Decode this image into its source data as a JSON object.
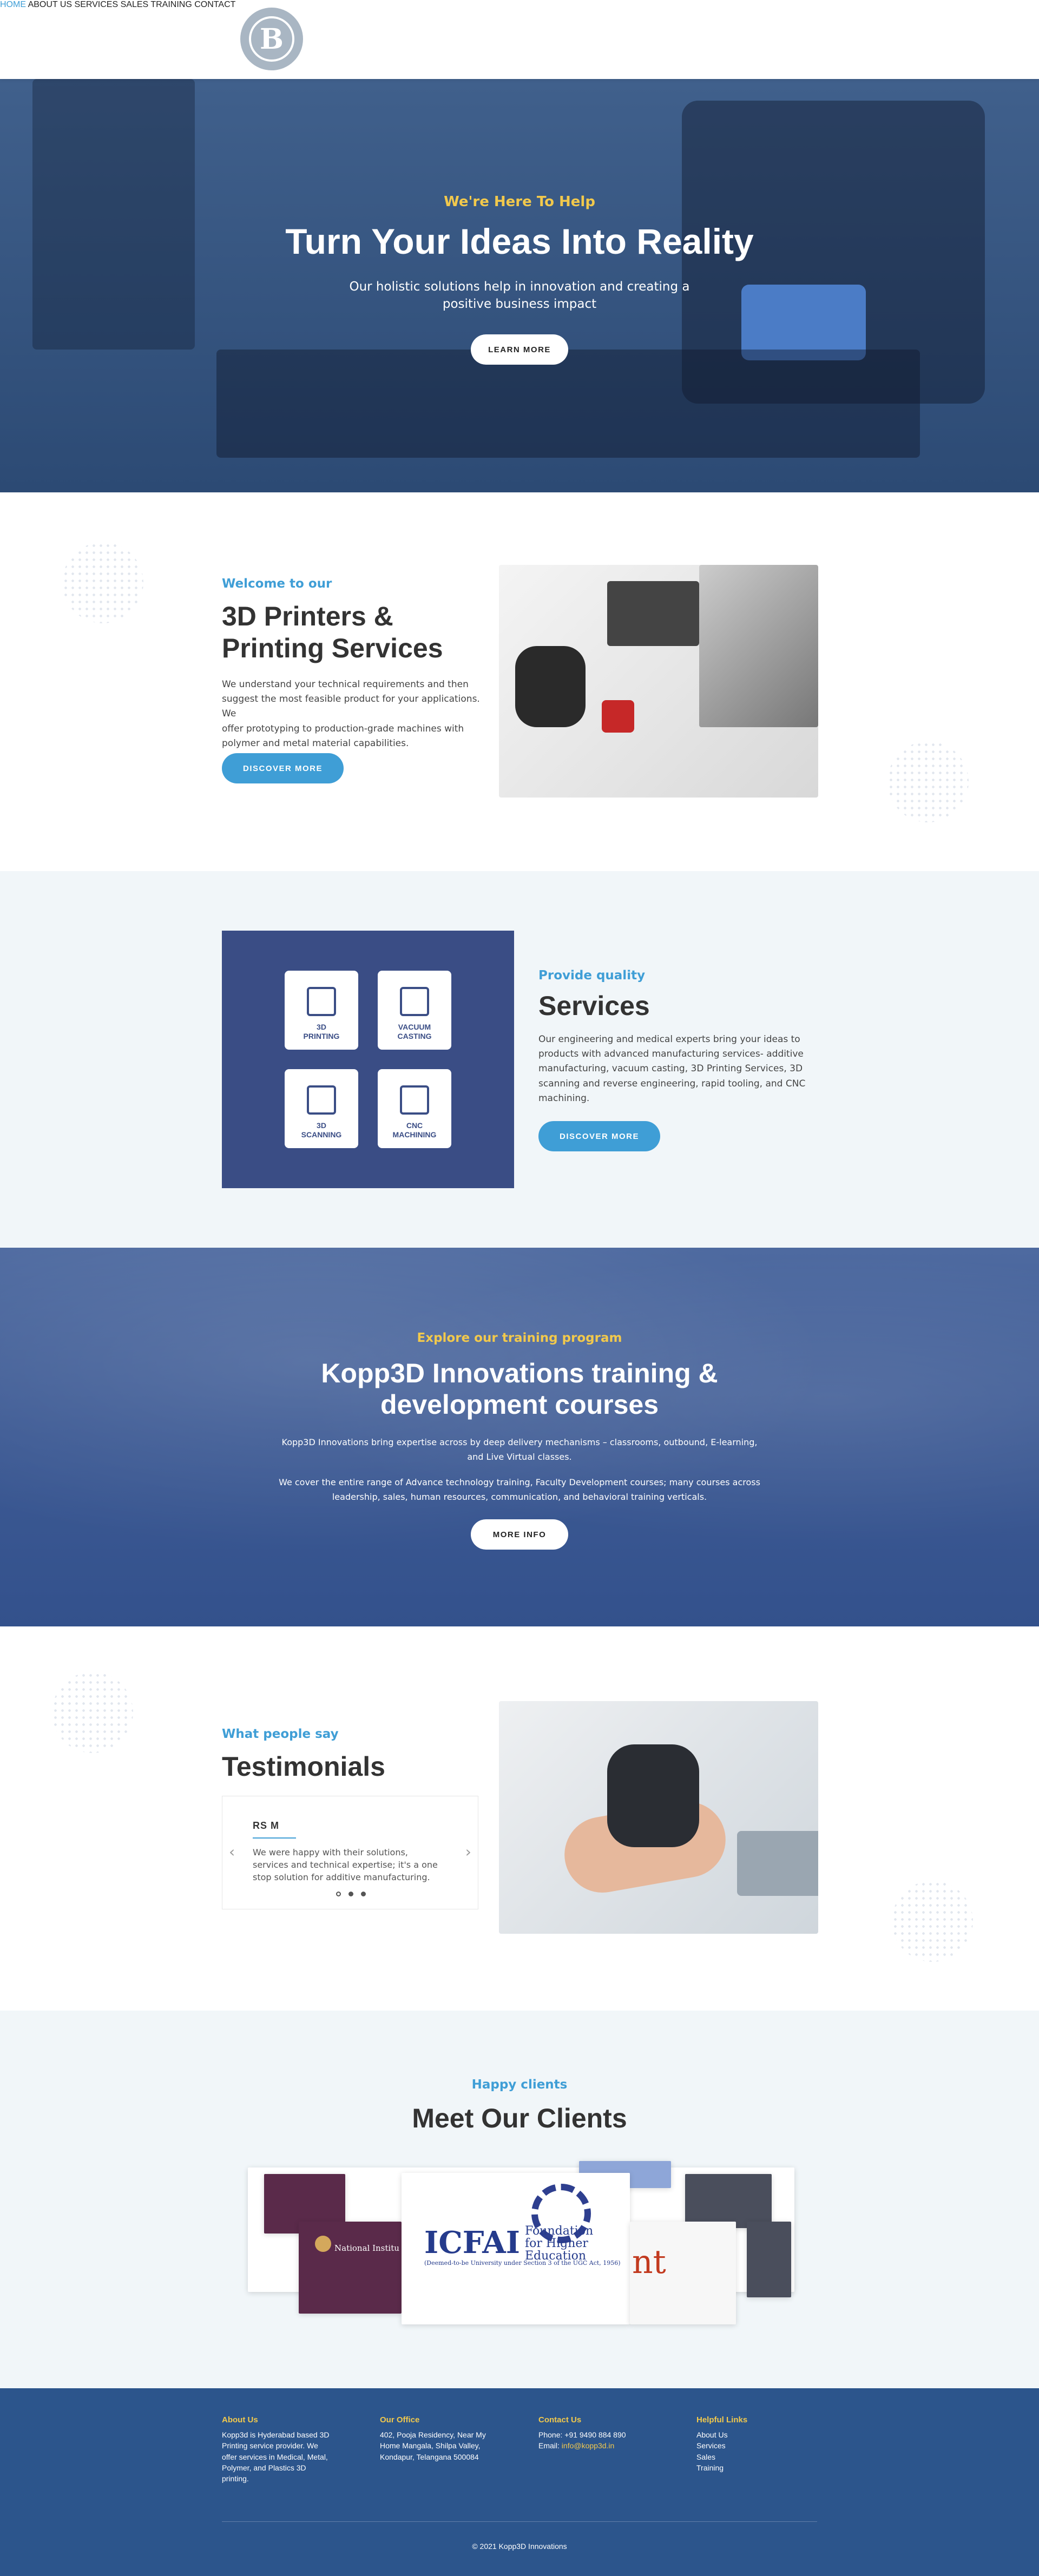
{
  "header": {
    "logo_text": "B",
    "nav": [
      "HOME",
      "ABOUT US",
      "SERVICES",
      "SALES",
      "TRAINING",
      "CONTACT"
    ],
    "active_nav": "HOME",
    "accent": "#3f9ed6"
  },
  "hero": {
    "kicker": "We're Here To Help",
    "title": "Turn Your Ideas Into Reality",
    "subtitle_line1": "Our holistic solutions help in innovation and creating a",
    "subtitle_line2": "positive business impact",
    "button": "LEARN MORE"
  },
  "welcome": {
    "kicker": "Welcome to our",
    "title_line1": "3D Printers &",
    "title_line2": "Printing Services",
    "text_lines": [
      "We understand your technical requirements and then",
      "suggest the most feasible product for your applications. We",
      "offer prototyping to production-grade machines with",
      "polymer and metal material capabilities."
    ],
    "button": "DISCOVER MORE"
  },
  "services": {
    "kicker": "Provide quality",
    "title": "Services",
    "text_lines": [
      "Our engineering and medical experts bring your ideas to",
      "products with advanced manufacturing services- additive",
      "manufacturing, vacuum casting, 3D Printing Services, 3D",
      "scanning and reverse engineering, rapid tooling, and CNC",
      "machining."
    ],
    "button": "DISCOVER MORE",
    "cards": [
      {
        "line1": "3D",
        "line2": "PRINTING",
        "icon": "printer-icon"
      },
      {
        "line1": "VACUUM",
        "line2": "CASTING",
        "icon": "casting-icon"
      },
      {
        "line1": "3D",
        "line2": "SCANNING",
        "icon": "scanner-icon"
      },
      {
        "line1": "CNC",
        "line2": "MACHINING",
        "icon": "cnc-icon"
      }
    ]
  },
  "training": {
    "kicker": "Explore our training program",
    "title_line1": "Kopp3D Innovations training &",
    "title_line2": "development courses",
    "para1_line1": "Kopp3D Innovations bring expertise across by deep delivery mechanisms – classrooms, outbound, E-learning,",
    "para1_line2": "and Live Virtual classes.",
    "para2_line1": "We cover the entire range of Advance technology training, Faculty Development courses; many courses across",
    "para2_line2": "leadership, sales, human resources, communication, and behavioral training verticals.",
    "button": "MORE INFO"
  },
  "testimonials": {
    "kicker": "What people say",
    "title": "Testimonials",
    "name": "RS M",
    "quote_lines": [
      "We were happy with their solutions,",
      "services and technical expertise; it's a one",
      "stop solution for additive manufacturing."
    ]
  },
  "clients": {
    "kicker": "Happy clients",
    "title": "Meet Our Clients",
    "icfai_line1": "ICFAI",
    "icfai_line2": "Foundation",
    "icfai_line3": "for Higher Education",
    "icfai_line4": "(Deemed-to-be University under Section 3 of the UGC Act, 1956)",
    "nit_small": "National Institu",
    "nt": "nt"
  },
  "footer": {
    "about_title": "About Us",
    "about_lines": [
      "Kopp3d is Hyderabad based 3D",
      "Printing service provider. We",
      "offer services in Medical, Metal,",
      "Polymer, and Plastics 3D",
      "printing."
    ],
    "office_title": "Our Office",
    "office_lines": [
      "402, Pooja Residency, Near My",
      "Home Mangala, Shilpa Valley,",
      "Kondapur, Telangana 500084"
    ],
    "contact_title": "Contact Us",
    "phone": "Phone: +91 9490 884 890",
    "email_label": "Email: ",
    "email": "info@kopp3d.in",
    "links_title": "Helpful Links",
    "links": [
      "About Us",
      "Services",
      "Sales",
      "Training"
    ],
    "copyright": "© 2021 Kopp3D Innovations"
  }
}
